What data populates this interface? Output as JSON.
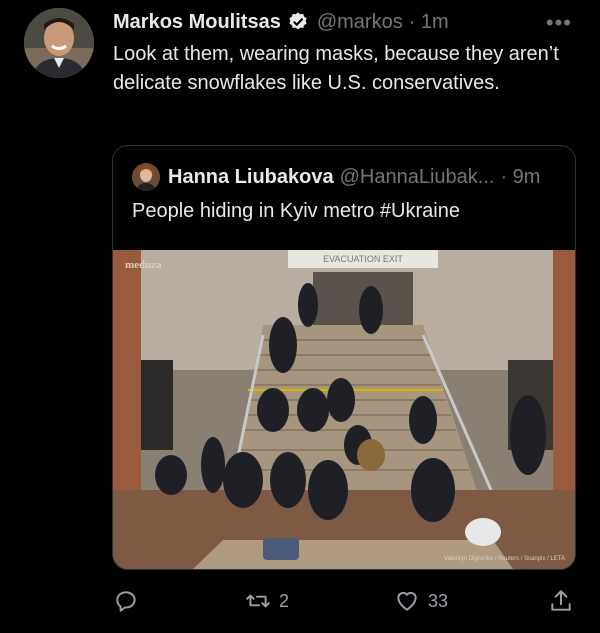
{
  "author": {
    "name": "Markos Moulitsas",
    "handle": "@markos",
    "time": "· 1m",
    "more": "•••"
  },
  "tweet": {
    "text": "Look at them, wearing masks, because they aren’t delicate snowflakes like U.S. conservatives."
  },
  "quote": {
    "name": "Hanna Liubakova",
    "handle": "@HannaLiubak...",
    "time": "· 9m",
    "text": "People hiding in Kyiv metro #Ukraine",
    "image": {
      "watermark": "meduza",
      "sign": "EVACUATION EXIT",
      "credit": "Valentyn Ogirenko / Reuters / Scanpix / LETA"
    }
  },
  "actions": {
    "reply_icon": "reply-icon",
    "retweet_icon": "retweet-icon",
    "retweet_count": "2",
    "like_icon": "heart-icon",
    "like_count": "33",
    "share_icon": "share-icon"
  },
  "colors": {
    "background": "#000000",
    "text": "#e7e9ea",
    "muted": "#71767b",
    "verified": "#1d9bf0",
    "border": "#2f3336"
  }
}
